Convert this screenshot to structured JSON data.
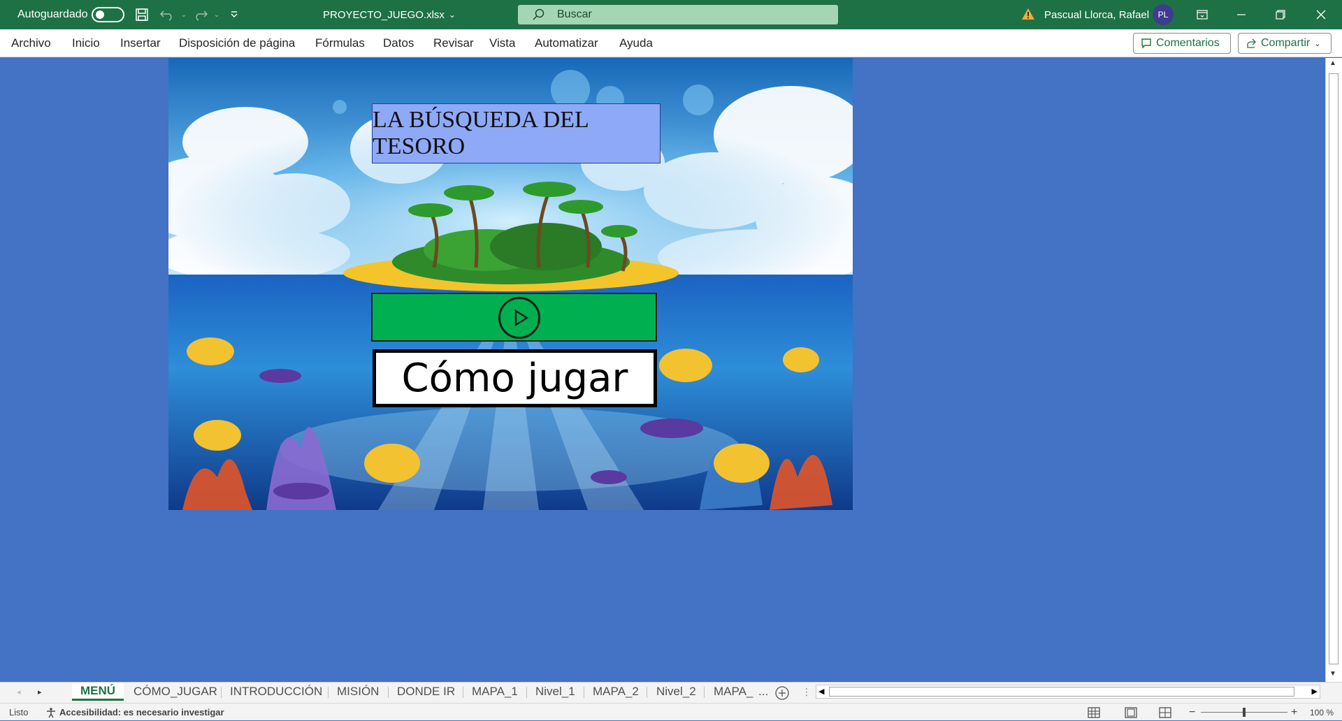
{
  "titlebar": {
    "autosave_label": "Autoguardado",
    "filename": "PROYECTO_JUEGO.xlsx",
    "search_placeholder": "Buscar",
    "user_name": "Pascual Llorca, Rafael",
    "user_initials": "PL",
    "accent": "#1e7145"
  },
  "menu": {
    "items": [
      "Archivo",
      "Inicio",
      "Insertar",
      "Disposición de página",
      "Fórmulas",
      "Datos",
      "Revisar",
      "Vista",
      "Automatizar",
      "Ayuda"
    ],
    "comments_label": "Comentarios",
    "share_label": "Compartir"
  },
  "scene": {
    "title": "LA BÚSQUEDA DEL TESORO",
    "how_to_play": "Cómo jugar",
    "play_button_color": "#00b050",
    "title_box_color": "#8ea9f7"
  },
  "sheet": {
    "background": "#4472C4"
  },
  "tabs": {
    "items": [
      "MENÚ",
      "CÓMO_JUGAR",
      "INTRODUCCIÓN",
      "MISIÓN",
      "DONDE IR",
      "MAPA_1",
      "Nivel_1",
      "MAPA_2",
      "Nivel_2",
      "MAPA_"
    ],
    "active": "MENÚ",
    "overflow": "..."
  },
  "status": {
    "ready": "Listo",
    "accessibility": "Accesibilidad: es necesario investigar",
    "zoom": "100 %",
    "zoom_fraction": 0.5
  }
}
